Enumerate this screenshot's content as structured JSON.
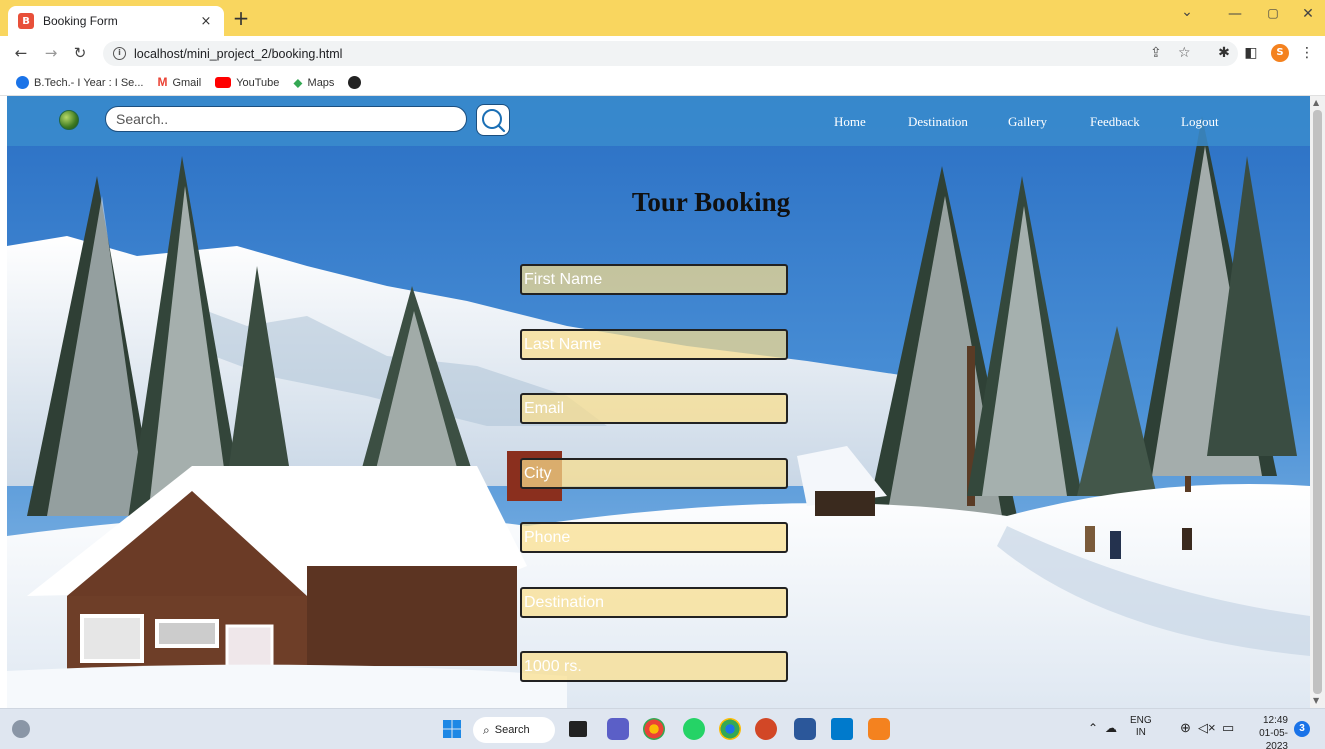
{
  "browser": {
    "tab_title": "Booking Form",
    "favicon_glyph": "B",
    "new_tab_glyph": "+",
    "close_glyph": "×",
    "url": "localhost/mini_project_2/booking.html",
    "profile_initial": "S",
    "bookmarks": [
      {
        "label": "B.Tech.- I Year : I Se...",
        "color": "#1a73e8"
      },
      {
        "label": "Gmail",
        "color": "#ea4335"
      },
      {
        "label": "YouTube",
        "color": "#ff0000"
      },
      {
        "label": "Maps",
        "color": "#34a853"
      }
    ]
  },
  "navbar": {
    "search_placeholder": "Search..",
    "links": [
      "Home",
      "Destination",
      "Gallery",
      "Feedback",
      "Logout"
    ]
  },
  "form": {
    "title": "Tour Booking",
    "fields": [
      {
        "placeholder": "First Name"
      },
      {
        "placeholder": "Last Name"
      },
      {
        "placeholder": "Email"
      },
      {
        "placeholder": "City"
      },
      {
        "placeholder": "Phone"
      },
      {
        "placeholder": "Destination"
      },
      {
        "placeholder": "1000 rs."
      }
    ]
  },
  "taskbar": {
    "search_label": "Search",
    "lang_top": "ENG",
    "lang_bottom": "IN",
    "time": "12:49",
    "date": "01-05-2023",
    "notification_count": "3"
  },
  "colors": {
    "tabstrip": "#f9d65f",
    "navbar": "#3a8ccd",
    "field_fill": "#fade8c"
  }
}
